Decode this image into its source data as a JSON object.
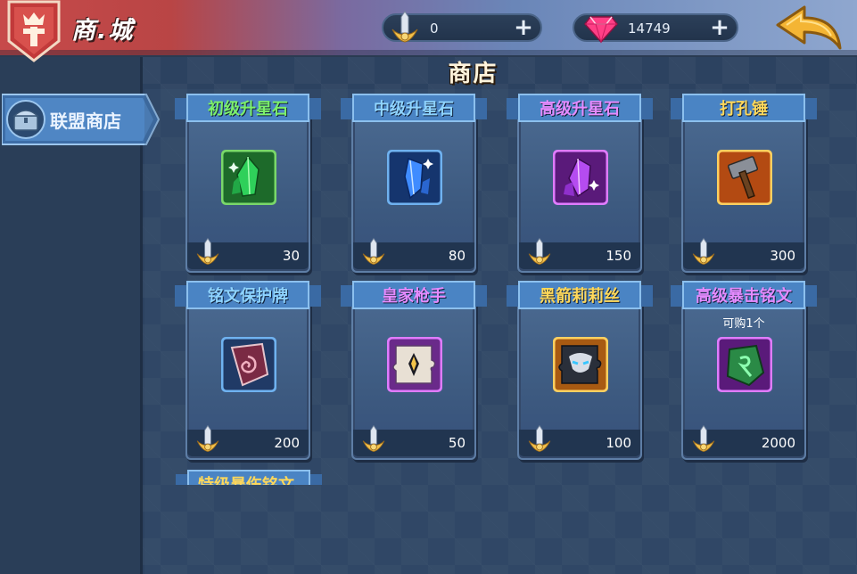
{
  "header": {
    "title": "商.城",
    "currency_coin": {
      "icon": "sword-medal-icon",
      "value": "0",
      "plus": "+"
    },
    "currency_gem": {
      "icon": "diamond-icon",
      "value": "14749",
      "plus": "+"
    }
  },
  "sidebar": {
    "tabs": [
      {
        "label": "联盟商店",
        "icon": "chest-icon",
        "active": true
      }
    ]
  },
  "shop": {
    "title": "商店",
    "items": [
      {
        "name": "初级升星石",
        "name_color": "#7cf06a",
        "icon": "green-crystal-icon",
        "price": "30",
        "note": ""
      },
      {
        "name": "中级升星石",
        "name_color": "#8fd4ff",
        "icon": "blue-crystal-icon",
        "price": "80",
        "note": ""
      },
      {
        "name": "高级升星石",
        "name_color": "#e58bff",
        "icon": "purple-crystal-icon",
        "price": "150",
        "note": ""
      },
      {
        "name": "打孔锤",
        "name_color": "#ffd85a",
        "icon": "hammer-icon",
        "price": "300",
        "note": ""
      },
      {
        "name": "铭文保护牌",
        "name_color": "#8fd4ff",
        "icon": "rune-shield-icon",
        "price": "200",
        "note": ""
      },
      {
        "name": "皇家枪手",
        "name_color": "#e58bff",
        "icon": "royal-gunner-shard-icon",
        "price": "50",
        "note": ""
      },
      {
        "name": "黑箭莉莉丝",
        "name_color": "#ffd85a",
        "icon": "black-arrow-lilith-shard-icon",
        "price": "100",
        "note": ""
      },
      {
        "name": "高级暴击铭文",
        "name_color": "#e58bff",
        "icon": "crit-rune-icon",
        "price": "2000",
        "note": "可购1个"
      }
    ],
    "partial_item_name": "特级暴伤铭文"
  },
  "colors": {
    "accent_gold": "#f2b233",
    "panel_blue": "#3d5a80",
    "ribbon_blue": "#4a78b2"
  }
}
